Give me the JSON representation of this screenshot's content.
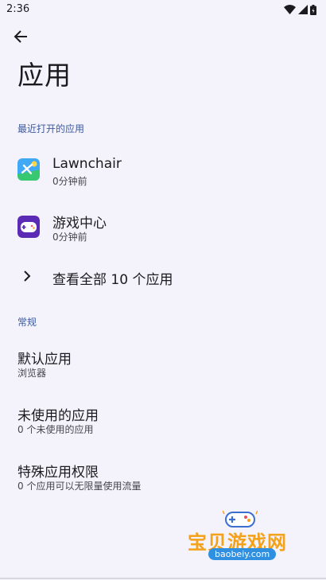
{
  "status_bar": {
    "time": "2:36",
    "icons": [
      "wifi-icon",
      "signal-icon",
      "battery-icon"
    ]
  },
  "header": {
    "back_icon": "arrow-left-icon",
    "title": "应用"
  },
  "recent_section": {
    "header": "最近打开的应用",
    "apps": [
      {
        "name": "Lawnchair",
        "subtitle": "0分钟前",
        "icon": "lawnchair-icon"
      },
      {
        "name": "游戏中心",
        "subtitle": "0分钟前",
        "icon": "game-center-icon"
      }
    ],
    "see_all": {
      "label": "查看全部 10 个应用",
      "icon": "chevron-right-icon"
    }
  },
  "general_section": {
    "header": "常规",
    "items": [
      {
        "title": "默认应用",
        "subtitle": "浏览器"
      },
      {
        "title": "未使用的应用",
        "subtitle": "0 个未使用的应用"
      },
      {
        "title": "特殊应用权限",
        "subtitle": "0 个应用可以无限量使用流量"
      }
    ]
  },
  "watermark": {
    "title": "宝贝游戏网",
    "url": "baobeiy.com"
  },
  "colors": {
    "background": "#f4f2fa",
    "section_header": "#3d5a9c",
    "text_primary": "#1b1b1f",
    "text_secondary": "#46464f"
  }
}
